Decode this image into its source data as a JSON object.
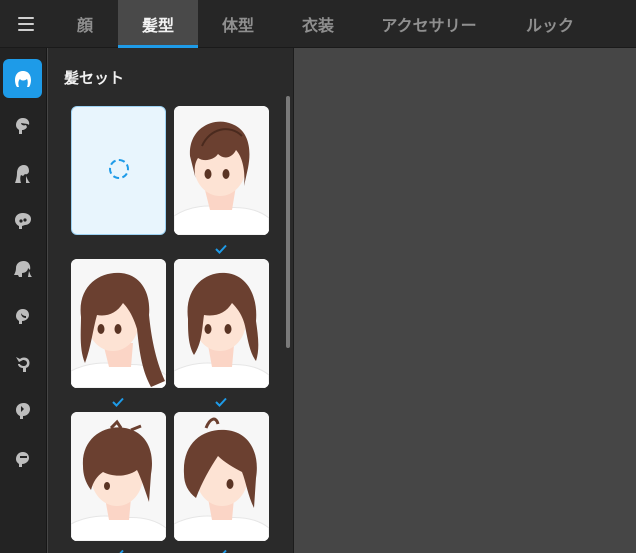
{
  "topbar": {
    "menu_icon": "hamburger-menu-icon",
    "tabs": [
      {
        "label": "顔",
        "active": false
      },
      {
        "label": "髪型",
        "active": true
      },
      {
        "label": "体型",
        "active": false
      },
      {
        "label": "衣装",
        "active": false
      },
      {
        "label": "アクセサリー",
        "active": false
      },
      {
        "label": "ルック",
        "active": false
      }
    ]
  },
  "sidebar": {
    "items": [
      {
        "icon": "hair-set-icon",
        "active": true
      },
      {
        "icon": "front-hair-icon",
        "active": false
      },
      {
        "icon": "back-hair-icon",
        "active": false
      },
      {
        "icon": "base-hair-icon",
        "active": false
      },
      {
        "icon": "side-hair-icon",
        "active": false
      },
      {
        "icon": "ahoge-icon",
        "active": false
      },
      {
        "icon": "hair-tail-icon",
        "active": false
      },
      {
        "icon": "hair-accessory-icon",
        "active": false
      },
      {
        "icon": "hair-color-icon",
        "active": false
      }
    ]
  },
  "panel": {
    "title": "髪セット",
    "presets": [
      {
        "kind": "empty",
        "checked": false
      },
      {
        "kind": "short",
        "checked": true
      },
      {
        "kind": "long",
        "checked": true
      },
      {
        "kind": "bob",
        "checked": true
      },
      {
        "kind": "messy",
        "checked": true
      },
      {
        "kind": "swept",
        "checked": true
      }
    ]
  },
  "colors": {
    "accent": "#1e9be8",
    "hair": "#6b4030",
    "hair_shade": "#4a2a1e",
    "skin": "#fde3d4"
  }
}
